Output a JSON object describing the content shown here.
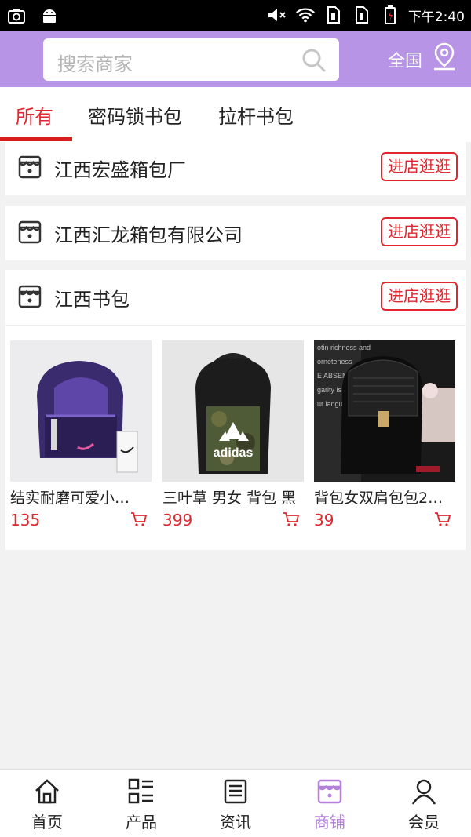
{
  "status_bar": {
    "time": "下午2:40",
    "icons": [
      "screenshot-icon",
      "android-icon",
      "mute-icon",
      "wifi-icon",
      "sim1-icon",
      "sim2-icon",
      "battery-icon"
    ]
  },
  "header": {
    "search_placeholder": "搜索商家",
    "region": "全国",
    "bg_color": "#b894e6"
  },
  "tabs": [
    {
      "label": "所有",
      "active": true
    },
    {
      "label": "密码锁书包",
      "active": false
    },
    {
      "label": "拉杆书包",
      "active": false
    }
  ],
  "stores": [
    {
      "name": "江西宏盛箱包厂",
      "button": "进店逛逛"
    },
    {
      "name": "江西汇龙箱包有限公司",
      "button": "进店逛逛"
    },
    {
      "name": "江西书包",
      "button": "进店逛逛",
      "products": [
        {
          "name": "结实耐磨可爱小…",
          "price": "135"
        },
        {
          "name": "三叶草 男女 背包 黑",
          "price": "399"
        },
        {
          "name": "背包女双肩包包2…",
          "price": "39"
        }
      ]
    }
  ],
  "product_images": {
    "p2_brand": "adidas",
    "p3_text": [
      "otin richness and",
      "orneteness",
      "E ABSENCE",
      "garity is",
      "ur langu"
    ]
  },
  "bottom_nav": [
    {
      "label": "首页",
      "icon": "home-icon",
      "active": false
    },
    {
      "label": "产品",
      "icon": "products-icon",
      "active": false
    },
    {
      "label": "资讯",
      "icon": "news-icon",
      "active": false
    },
    {
      "label": "商铺",
      "icon": "shop-icon",
      "active": true
    },
    {
      "label": "会员",
      "icon": "member-icon",
      "active": false
    }
  ],
  "colors": {
    "accent_red": "#e0262e",
    "nav_active": "#b57fdc"
  }
}
